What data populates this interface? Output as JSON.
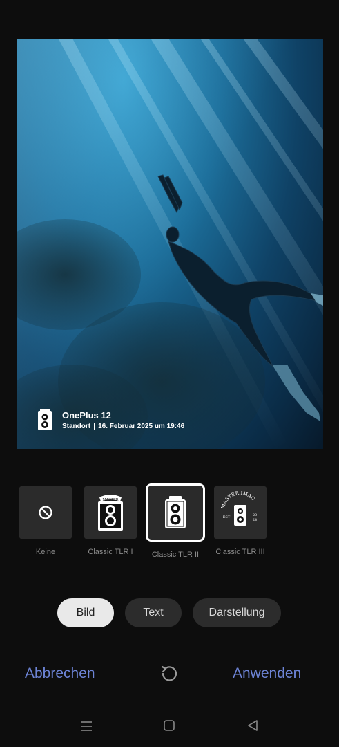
{
  "photo": {
    "watermark": {
      "device": "OnePlus 12",
      "location": "Standort",
      "date": "16. Februar 2025 um 19:46",
      "icon": "tlr-camera-icon"
    }
  },
  "templates": [
    {
      "label": "Keine",
      "icon": "none-icon",
      "selected": false
    },
    {
      "label": "Classic TLR I",
      "icon": "tlr-master-icon",
      "selected": false
    },
    {
      "label": "Classic TLR II",
      "icon": "tlr-camera-icon",
      "selected": true
    },
    {
      "label": "Classic TLR III",
      "icon": "master-image-badge-icon",
      "selected": false
    }
  ],
  "tabs": [
    {
      "label": "Bild",
      "active": true
    },
    {
      "label": "Text",
      "active": false
    },
    {
      "label": "Darstellung",
      "active": false
    }
  ],
  "actions": {
    "cancel": "Abbrechen",
    "apply": "Anwenden",
    "reset_icon": "reset-icon"
  },
  "navbar": {
    "menu_icon": "menu-icon",
    "home_icon": "home-icon",
    "back_icon": "back-icon"
  },
  "colors": {
    "accent": "#6d84d6",
    "background": "#0d0d0d",
    "tab_active": "#e9e9e9",
    "tab_inactive": "#2c2c2c"
  },
  "badges": {
    "master": "MASTER",
    "master_image": "MASTER IMAG",
    "est": "EST",
    "year_top": "20",
    "year_bottom": "24"
  }
}
